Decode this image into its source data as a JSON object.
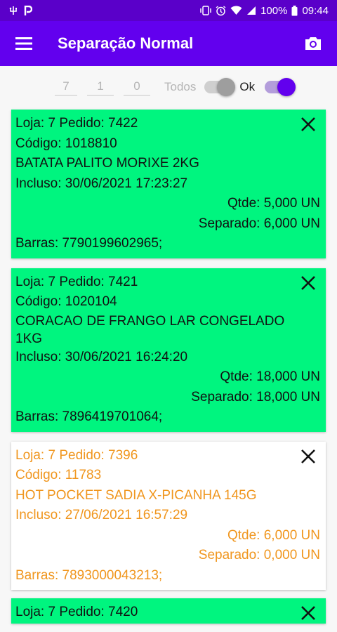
{
  "status": {
    "battery": "100%",
    "time": "09:44"
  },
  "appbar": {
    "title": "Separação Normal"
  },
  "filters": {
    "loja": "7",
    "field2": "1",
    "field3": "0",
    "todos_label": "Todos",
    "ok_label": "Ok"
  },
  "orders": [
    {
      "line1": "Loja: 7 Pedido: 7422",
      "codigo": "Código: 1018810",
      "descricao": "BATATA PALITO MORIXE  2KG",
      "incluso": "Incluso: 30/06/2021 17:23:27",
      "qtde": "Qtde: 5,000 UN",
      "separado": "Separado: 6,000 UN",
      "barras": "Barras: 7790199602965;"
    },
    {
      "line1": "Loja: 7 Pedido: 7421",
      "codigo": "Código: 1020104",
      "descricao": "CORACAO DE FRANGO LAR CONGELADO 1KG",
      "incluso": "Incluso: 30/06/2021 16:24:20",
      "qtde": "Qtde: 18,000 UN",
      "separado": "Separado: 18,000 UN",
      "barras": "Barras: 7896419701064;"
    },
    {
      "line1": "Loja: 7 Pedido: 7396",
      "codigo": "Código: 11783",
      "descricao": "HOT POCKET SADIA X-PICANHA 145G",
      "incluso": "Incluso: 27/06/2021 16:57:29",
      "qtde": "Qtde: 6,000 UN",
      "separado": "Separado: 0,000 UN",
      "barras": "Barras: 7893000043213;"
    },
    {
      "line1": "Loja: 7 Pedido: 7420"
    }
  ],
  "colors": {
    "primary": "#6200ee",
    "statusbar": "#5a00c9",
    "card_done": "#00f57f",
    "card_pending_text": "#f0961e"
  }
}
